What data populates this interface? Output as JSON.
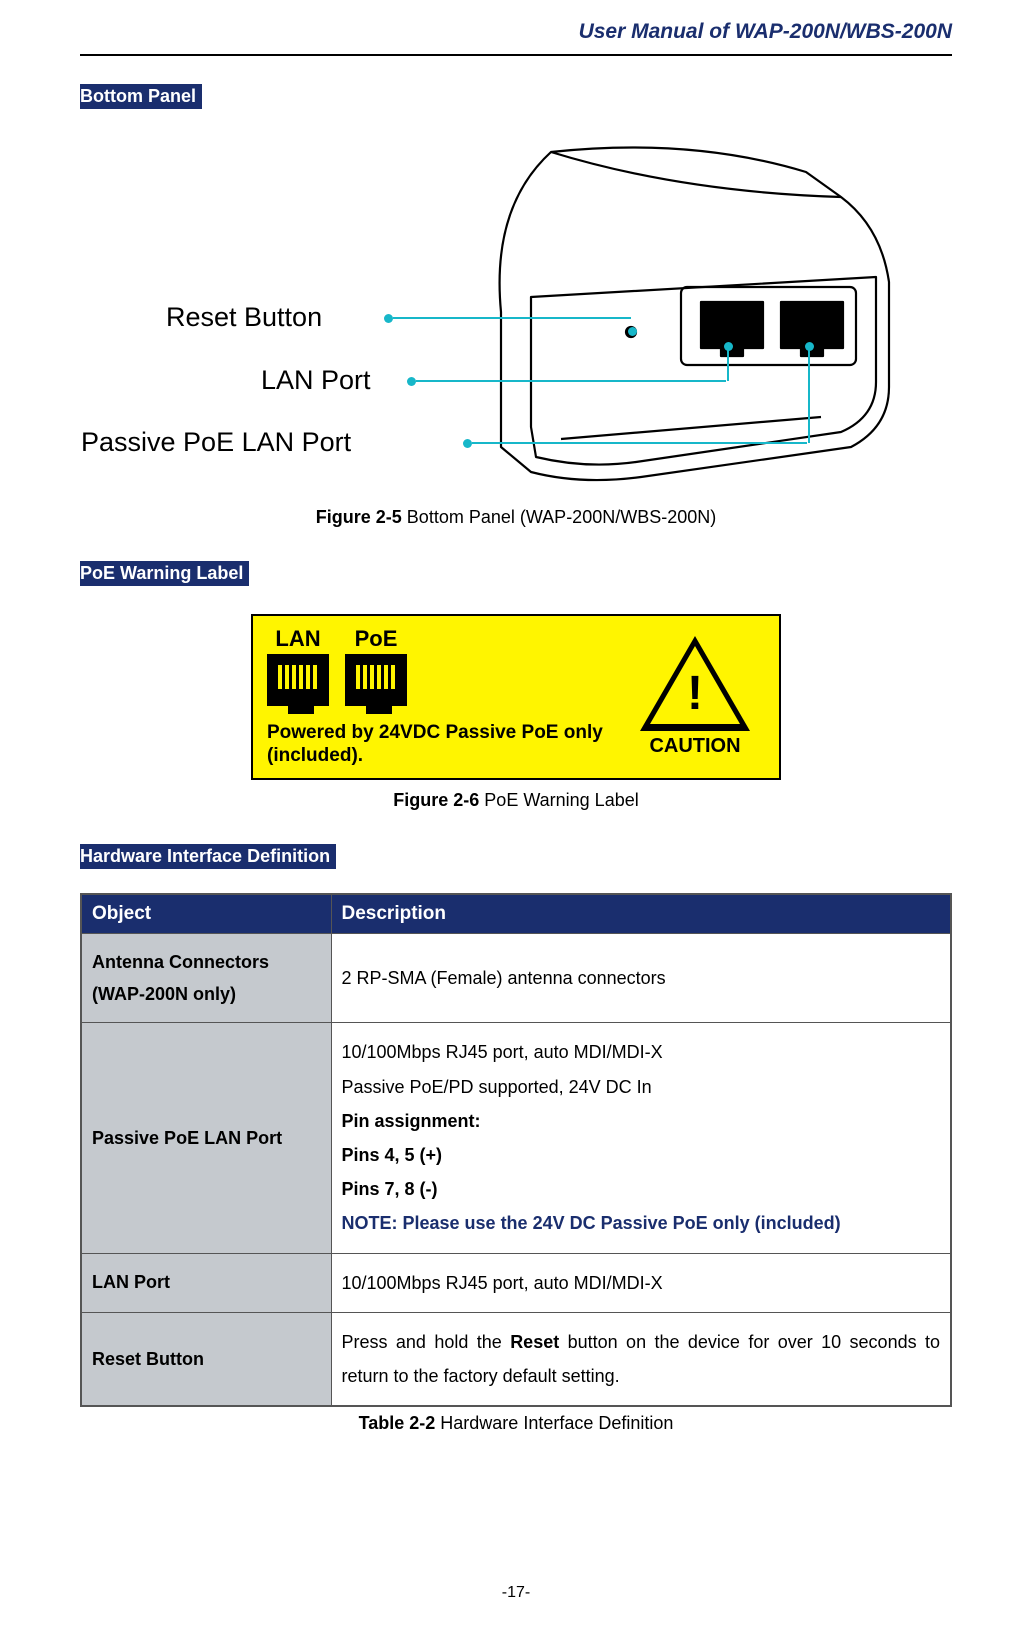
{
  "header": {
    "title": "User Manual of WAP-200N/WBS-200N"
  },
  "sections": {
    "bottom_panel_heading": "Bottom Panel",
    "poe_warning_heading": "PoE Warning Label",
    "hw_def_heading": "Hardware Interface Definition"
  },
  "figure_bottom_panel": {
    "label_bold": "Figure 2-5",
    "label_rest": " Bottom Panel (WAP-200N/WBS-200N)",
    "callouts": {
      "reset": "Reset Button",
      "lan": "LAN Port",
      "poe": "Passive PoE LAN Port"
    }
  },
  "figure_poe": {
    "label_bold": "Figure 2-6",
    "label_rest": " PoE Warning Label",
    "port_lan": "LAN",
    "port_poe": "PoE",
    "text": "Powered by 24VDC Passive PoE only (included).",
    "caution": "CAUTION"
  },
  "table": {
    "caption_bold": "Table 2-2",
    "caption_rest": " Hardware Interface Definition",
    "headers": {
      "object": "Object",
      "description": "Description"
    },
    "rows": {
      "antenna": {
        "obj_line1": "Antenna Connectors",
        "obj_line2": "(WAP-200N only)",
        "desc": "2 RP-SMA (Female) antenna connectors"
      },
      "poe_port": {
        "obj": "Passive PoE LAN Port",
        "l1": "10/100Mbps RJ45 port, auto MDI/MDI-X",
        "l2": "Passive PoE/PD supported, 24V DC In",
        "l3": "Pin assignment:",
        "l4": "Pins 4, 5 (+)",
        "l5": "Pins 7, 8 (-)",
        "note": "NOTE: Please use the 24V DC Passive PoE only (included)"
      },
      "lan_port": {
        "obj": "LAN Port",
        "desc": "10/100Mbps RJ45 port, auto MDI/MDI-X"
      },
      "reset": {
        "obj": "Reset Button",
        "pre": "Press and hold the ",
        "bold": "Reset",
        "post": " button on the device for over 10 seconds to return to the factory default setting."
      }
    }
  },
  "page_number": "-17-"
}
